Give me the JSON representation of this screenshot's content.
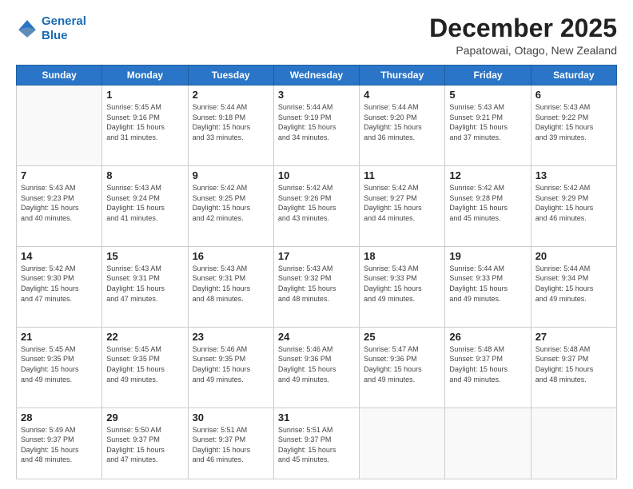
{
  "logo": {
    "line1": "General",
    "line2": "Blue"
  },
  "header": {
    "month": "December 2025",
    "location": "Papatowai, Otago, New Zealand"
  },
  "days": [
    "Sunday",
    "Monday",
    "Tuesday",
    "Wednesday",
    "Thursday",
    "Friday",
    "Saturday"
  ],
  "weeks": [
    [
      {
        "day": "",
        "content": ""
      },
      {
        "day": "1",
        "content": "Sunrise: 5:45 AM\nSunset: 9:16 PM\nDaylight: 15 hours\nand 31 minutes."
      },
      {
        "day": "2",
        "content": "Sunrise: 5:44 AM\nSunset: 9:18 PM\nDaylight: 15 hours\nand 33 minutes."
      },
      {
        "day": "3",
        "content": "Sunrise: 5:44 AM\nSunset: 9:19 PM\nDaylight: 15 hours\nand 34 minutes."
      },
      {
        "day": "4",
        "content": "Sunrise: 5:44 AM\nSunset: 9:20 PM\nDaylight: 15 hours\nand 36 minutes."
      },
      {
        "day": "5",
        "content": "Sunrise: 5:43 AM\nSunset: 9:21 PM\nDaylight: 15 hours\nand 37 minutes."
      },
      {
        "day": "6",
        "content": "Sunrise: 5:43 AM\nSunset: 9:22 PM\nDaylight: 15 hours\nand 39 minutes."
      }
    ],
    [
      {
        "day": "7",
        "content": "Sunrise: 5:43 AM\nSunset: 9:23 PM\nDaylight: 15 hours\nand 40 minutes."
      },
      {
        "day": "8",
        "content": "Sunrise: 5:43 AM\nSunset: 9:24 PM\nDaylight: 15 hours\nand 41 minutes."
      },
      {
        "day": "9",
        "content": "Sunrise: 5:42 AM\nSunset: 9:25 PM\nDaylight: 15 hours\nand 42 minutes."
      },
      {
        "day": "10",
        "content": "Sunrise: 5:42 AM\nSunset: 9:26 PM\nDaylight: 15 hours\nand 43 minutes."
      },
      {
        "day": "11",
        "content": "Sunrise: 5:42 AM\nSunset: 9:27 PM\nDaylight: 15 hours\nand 44 minutes."
      },
      {
        "day": "12",
        "content": "Sunrise: 5:42 AM\nSunset: 9:28 PM\nDaylight: 15 hours\nand 45 minutes."
      },
      {
        "day": "13",
        "content": "Sunrise: 5:42 AM\nSunset: 9:29 PM\nDaylight: 15 hours\nand 46 minutes."
      }
    ],
    [
      {
        "day": "14",
        "content": "Sunrise: 5:42 AM\nSunset: 9:30 PM\nDaylight: 15 hours\nand 47 minutes."
      },
      {
        "day": "15",
        "content": "Sunrise: 5:43 AM\nSunset: 9:31 PM\nDaylight: 15 hours\nand 47 minutes."
      },
      {
        "day": "16",
        "content": "Sunrise: 5:43 AM\nSunset: 9:31 PM\nDaylight: 15 hours\nand 48 minutes."
      },
      {
        "day": "17",
        "content": "Sunrise: 5:43 AM\nSunset: 9:32 PM\nDaylight: 15 hours\nand 48 minutes."
      },
      {
        "day": "18",
        "content": "Sunrise: 5:43 AM\nSunset: 9:33 PM\nDaylight: 15 hours\nand 49 minutes."
      },
      {
        "day": "19",
        "content": "Sunrise: 5:44 AM\nSunset: 9:33 PM\nDaylight: 15 hours\nand 49 minutes."
      },
      {
        "day": "20",
        "content": "Sunrise: 5:44 AM\nSunset: 9:34 PM\nDaylight: 15 hours\nand 49 minutes."
      }
    ],
    [
      {
        "day": "21",
        "content": "Sunrise: 5:45 AM\nSunset: 9:35 PM\nDaylight: 15 hours\nand 49 minutes."
      },
      {
        "day": "22",
        "content": "Sunrise: 5:45 AM\nSunset: 9:35 PM\nDaylight: 15 hours\nand 49 minutes."
      },
      {
        "day": "23",
        "content": "Sunrise: 5:46 AM\nSunset: 9:35 PM\nDaylight: 15 hours\nand 49 minutes."
      },
      {
        "day": "24",
        "content": "Sunrise: 5:46 AM\nSunset: 9:36 PM\nDaylight: 15 hours\nand 49 minutes."
      },
      {
        "day": "25",
        "content": "Sunrise: 5:47 AM\nSunset: 9:36 PM\nDaylight: 15 hours\nand 49 minutes."
      },
      {
        "day": "26",
        "content": "Sunrise: 5:48 AM\nSunset: 9:37 PM\nDaylight: 15 hours\nand 49 minutes."
      },
      {
        "day": "27",
        "content": "Sunrise: 5:48 AM\nSunset: 9:37 PM\nDaylight: 15 hours\nand 48 minutes."
      }
    ],
    [
      {
        "day": "28",
        "content": "Sunrise: 5:49 AM\nSunset: 9:37 PM\nDaylight: 15 hours\nand 48 minutes."
      },
      {
        "day": "29",
        "content": "Sunrise: 5:50 AM\nSunset: 9:37 PM\nDaylight: 15 hours\nand 47 minutes."
      },
      {
        "day": "30",
        "content": "Sunrise: 5:51 AM\nSunset: 9:37 PM\nDaylight: 15 hours\nand 46 minutes."
      },
      {
        "day": "31",
        "content": "Sunrise: 5:51 AM\nSunset: 9:37 PM\nDaylight: 15 hours\nand 45 minutes."
      },
      {
        "day": "",
        "content": ""
      },
      {
        "day": "",
        "content": ""
      },
      {
        "day": "",
        "content": ""
      }
    ]
  ]
}
